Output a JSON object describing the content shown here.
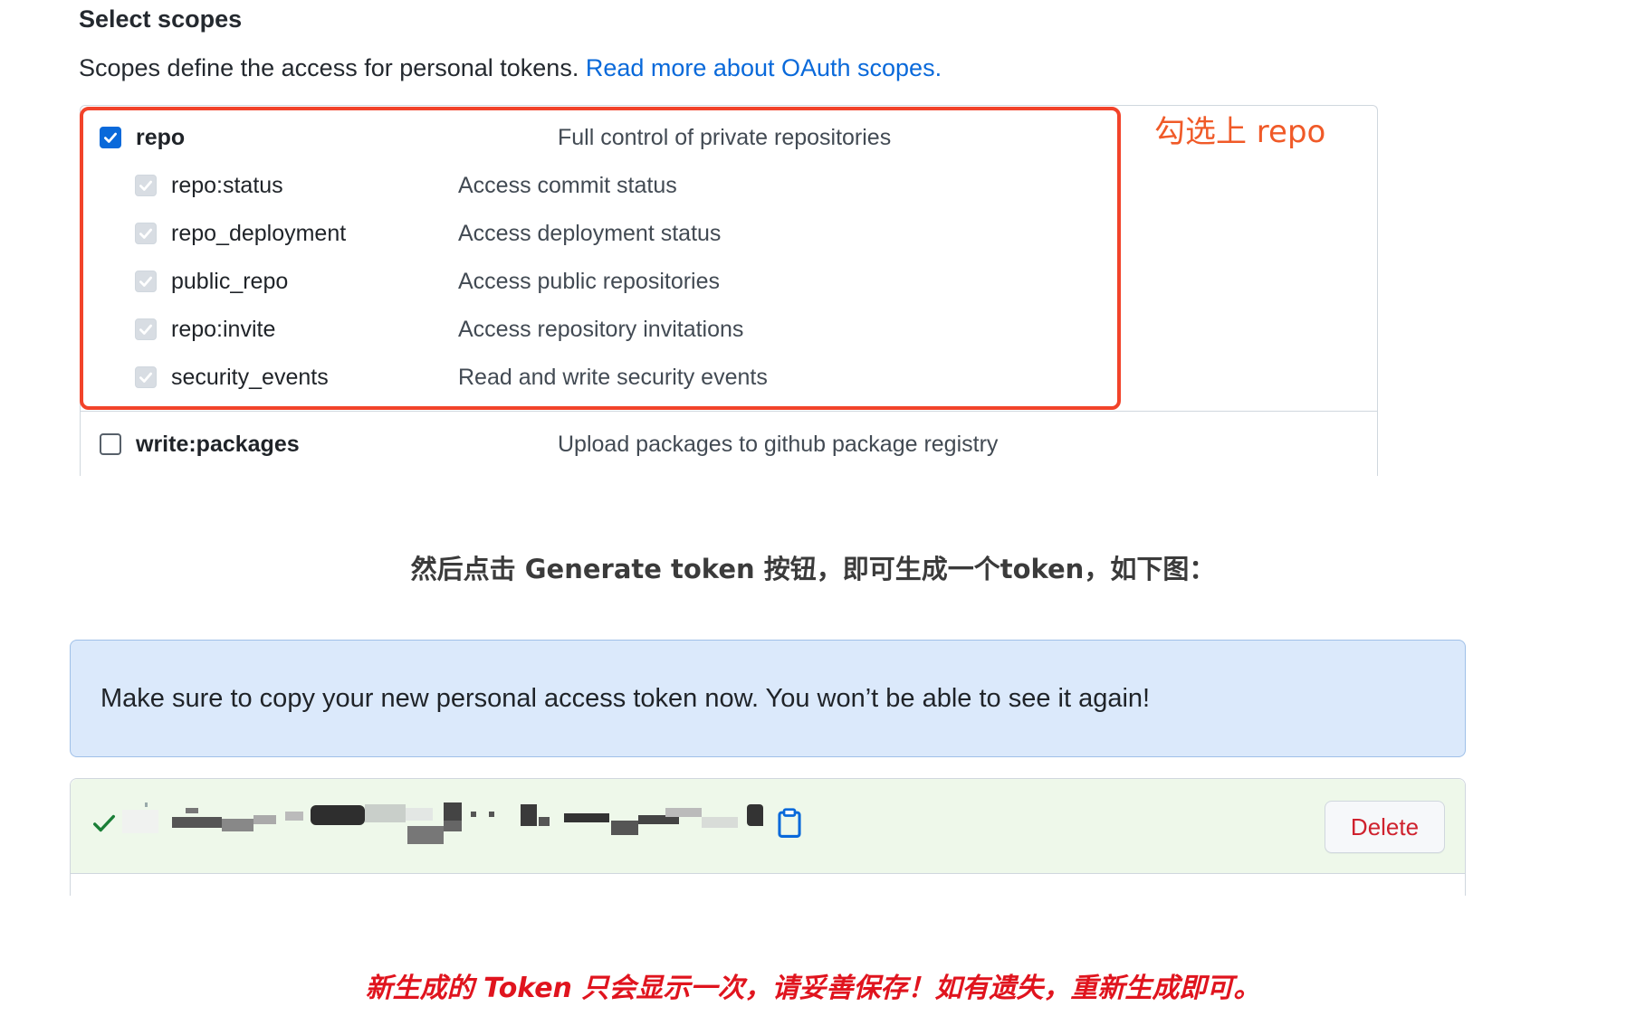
{
  "scopes": {
    "heading": "Select scopes",
    "description": "Scopes define the access for personal tokens.",
    "link": "Read more about OAuth scopes.",
    "items": [
      {
        "name": "repo",
        "desc": "Full control of private repositories",
        "state": "checked"
      },
      {
        "name": "repo:status",
        "desc": "Access commit status",
        "state": "disabled-checked"
      },
      {
        "name": "repo_deployment",
        "desc": "Access deployment status",
        "state": "disabled-checked"
      },
      {
        "name": "public_repo",
        "desc": "Access public repositories",
        "state": "disabled-checked"
      },
      {
        "name": "repo:invite",
        "desc": "Access repository invitations",
        "state": "disabled-checked"
      },
      {
        "name": "security_events",
        "desc": "Read and write security events",
        "state": "disabled-checked"
      },
      {
        "name": "write:packages",
        "desc": "Upload packages to github package registry",
        "state": "unchecked"
      }
    ]
  },
  "annotation": {
    "select_repo": "勾选上 repo",
    "instruction": "然后点击 Generate token 按钮，即可生成一个token，如下图：",
    "footer_note": "新生成的 Token 只会显示一次，请妥善保存！如有遗失，重新生成即可。"
  },
  "flash": {
    "message": "Make sure to copy your new personal access token now. You won’t be able to see it again!"
  },
  "token": {
    "delete_label": "Delete",
    "icons": [
      "check-icon",
      "copy-icon"
    ]
  },
  "colors": {
    "link": "#0969da",
    "highlight_red": "#f2432a",
    "note_orange": "#f05a28",
    "danger": "#cf222e",
    "flash_bg": "#dbe9fb",
    "token_bg": "#eef8ea"
  }
}
